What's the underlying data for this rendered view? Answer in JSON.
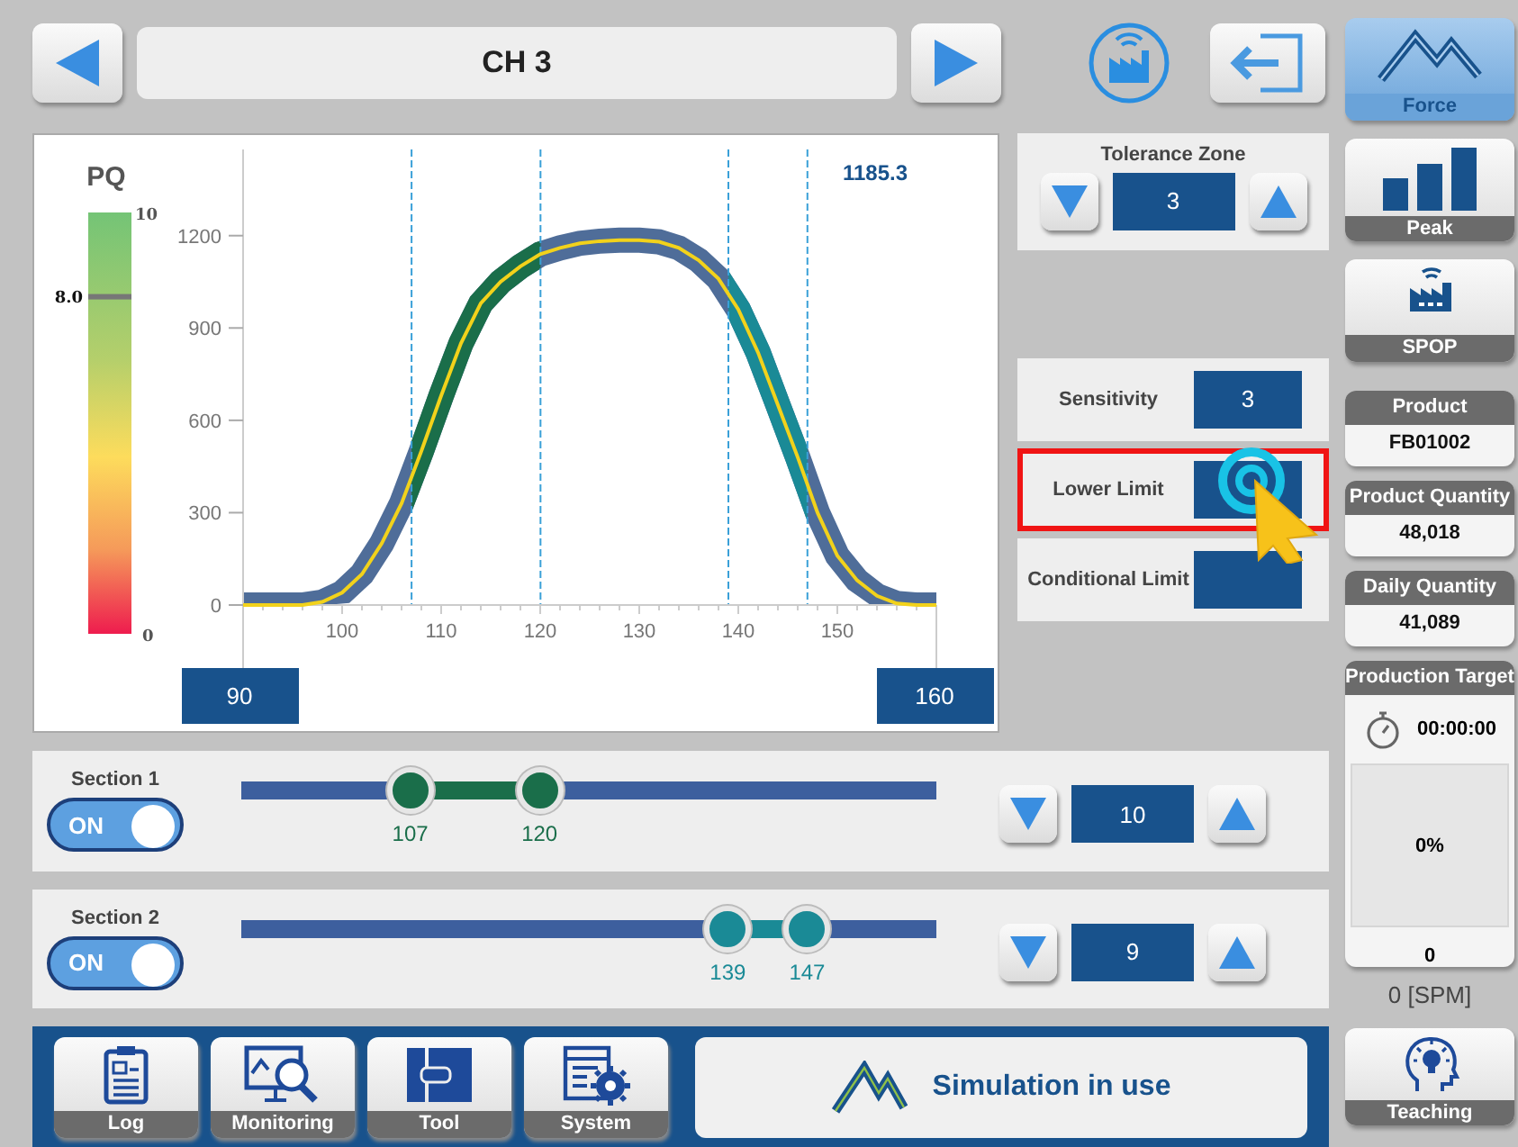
{
  "header": {
    "title": "CH 3"
  },
  "modes": [
    {
      "kind": "force",
      "label": "Force",
      "selected": true
    },
    {
      "kind": "peak",
      "label": "Peak",
      "selected": false
    },
    {
      "kind": "spop",
      "label": "SPOP",
      "selected": false
    }
  ],
  "chart_panel": {
    "pq": {
      "label": "PQ",
      "max": "10",
      "min": "0",
      "marker": "8.0",
      "level": 0.8
    },
    "reading": "1185.3",
    "chart_data": {
      "type": "line",
      "x": [
        90,
        92,
        94,
        96,
        98,
        100,
        102,
        104,
        106,
        108,
        110,
        112,
        114,
        116,
        118,
        120,
        122,
        124,
        126,
        128,
        130,
        132,
        134,
        136,
        138,
        140,
        142,
        144,
        146,
        148,
        150,
        152,
        154,
        156,
        158,
        160
      ],
      "series": [
        {
          "color": "#f2d21b",
          "values": [
            0,
            0,
            0,
            0,
            10,
            40,
            100,
            200,
            330,
            500,
            680,
            850,
            980,
            1050,
            1100,
            1140,
            1160,
            1175,
            1182,
            1185,
            1185,
            1180,
            1160,
            1120,
            1060,
            960,
            820,
            650,
            480,
            300,
            160,
            80,
            30,
            5,
            0,
            0
          ]
        }
      ],
      "xlim": [
        90,
        160
      ],
      "ylim": [
        0,
        1480
      ],
      "xticks": [
        100,
        110,
        120,
        130,
        140,
        150
      ],
      "yticks": [
        0,
        300,
        600,
        900,
        1200
      ]
    },
    "range_start": "90",
    "range_end": "160"
  },
  "tolerance_zone": {
    "label": "Tolerance Zone",
    "value": "3"
  },
  "settings": [
    {
      "label": "Sensitivity",
      "value": "3",
      "highlighted": false
    },
    {
      "label": "Lower Limit",
      "highlighted": true
    },
    {
      "label": "Conditional Limit",
      "highlighted": false
    }
  ],
  "sections": [
    {
      "name": "Section 1",
      "toggle": {
        "label": "ON",
        "on": true
      },
      "color": "#1a6e4a",
      "value": "10",
      "handles": [
        {
          "value": "107",
          "level": 0.243
        },
        {
          "value": "120",
          "level": 0.429
        }
      ]
    },
    {
      "name": "Section 2",
      "toggle": {
        "label": "ON",
        "on": true
      },
      "color": "#1a8a96",
      "value": "9",
      "handles": [
        {
          "value": "139",
          "level": 0.7
        },
        {
          "value": "147",
          "level": 0.814
        }
      ]
    }
  ],
  "info": [
    {
      "label": "Product",
      "value": "FB01002"
    },
    {
      "label": "Product Quantity",
      "value": "48,018"
    },
    {
      "label": "Daily Quantity",
      "value": "41,089"
    }
  ],
  "production_target": {
    "label": "Production Target",
    "time": "00:00:00",
    "percent": "0%",
    "count": "0"
  },
  "spm": "0 [SPM]",
  "bottom_nav": [
    {
      "kind": "log",
      "label": "Log"
    },
    {
      "kind": "monitoring",
      "label": "Monitoring"
    },
    {
      "kind": "tool",
      "label": "Tool"
    },
    {
      "kind": "system",
      "label": "System"
    }
  ],
  "status": "Simulation in use",
  "teaching": {
    "label": "Teaching"
  }
}
